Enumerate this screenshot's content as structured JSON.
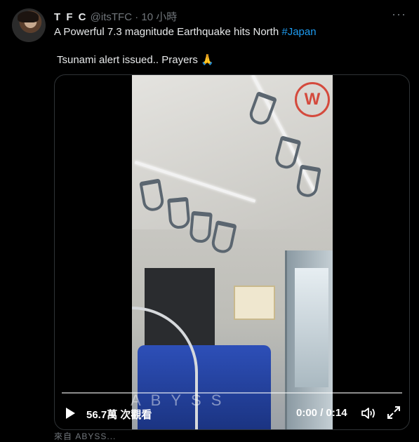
{
  "tweet": {
    "display_name": "T F C",
    "handle": "@itsTFC",
    "separator": "·",
    "time_ago": "10 小時",
    "more_label": "···",
    "text_line1": "A Powerful 7.3 magnitude Earthquake hits North ",
    "hashtag": "#Japan",
    "text_line2": "Tsunami alert issued.. Prayers 🙏",
    "source_partial": "來自 ABYSS..."
  },
  "video": {
    "views": "56.7萬 次觀看",
    "time": "0:00 / 0:14",
    "watermark": "ABYSS",
    "progress": 0
  },
  "icons": {
    "play": "play-icon",
    "volume": "volume-icon",
    "fullscreen": "fullscreen-icon",
    "more": "more-icon"
  },
  "colors": {
    "background": "#000000",
    "text": "#e7e9ea",
    "muted": "#71767b",
    "link": "#1d9bf0",
    "logo": "#d44a3d"
  }
}
